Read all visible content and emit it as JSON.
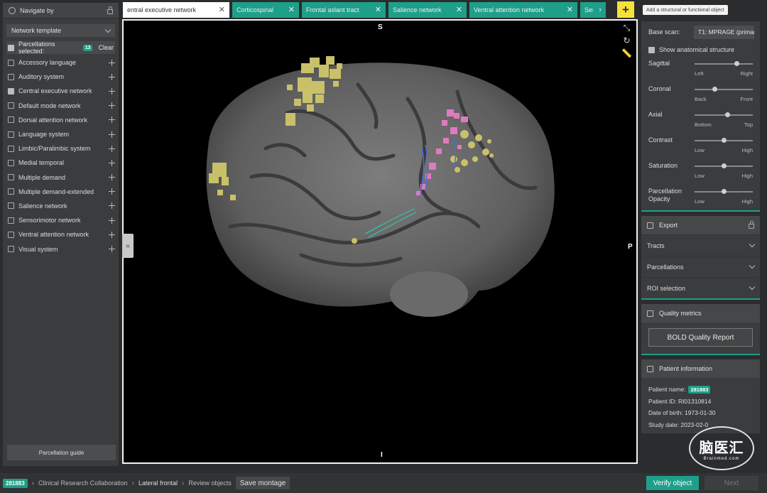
{
  "sidebar": {
    "title": "Navigate by",
    "template_select": "Network template",
    "selected_label": "Parcellations selected:",
    "selected_count": "13",
    "clear_label": "Clear",
    "networks": [
      {
        "label": "Accessory language",
        "checked": false
      },
      {
        "label": "Auditory system",
        "checked": false
      },
      {
        "label": "Central executive network",
        "checked": true
      },
      {
        "label": "Default mode network",
        "checked": false
      },
      {
        "label": "Dorsal attention network",
        "checked": false
      },
      {
        "label": "Language system",
        "checked": false
      },
      {
        "label": "Limbic/Paralimbic system",
        "checked": false
      },
      {
        "label": "Medial temporal",
        "checked": false
      },
      {
        "label": "Multiple demand",
        "checked": false
      },
      {
        "label": "Multiple demand-extended",
        "checked": false
      },
      {
        "label": "Salience network",
        "checked": false
      },
      {
        "label": "Sensorimotor network",
        "checked": false
      },
      {
        "label": "Ventral attention network",
        "checked": false
      },
      {
        "label": "Visual system",
        "checked": false
      }
    ],
    "guide_button": "Parcellation guide"
  },
  "tabs": [
    {
      "label": "entral executive network",
      "active": true
    },
    {
      "label": "Corticospinal",
      "active": false
    },
    {
      "label": "Frontal aslant tract",
      "active": false
    },
    {
      "label": "Salience network",
      "active": false
    },
    {
      "label": "Ventral attention network",
      "active": false
    },
    {
      "label": "Senso",
      "active": false
    }
  ],
  "add_button": "+",
  "add_tooltip": "Add a structural or functional object",
  "viewer": {
    "orient_top": "S",
    "orient_right": "P",
    "orient_bottom": "I",
    "collapse_glyph": "«"
  },
  "right": {
    "base_scan_label": "Base scan:",
    "base_scan_value": "T1: MPRAGE (primar",
    "show_anatomical": "Show anatomical structure",
    "sliders": [
      {
        "name": "Sagittal",
        "lo": "Left",
        "hi": "Right",
        "value": 0.72
      },
      {
        "name": "Coronal",
        "lo": "Back",
        "hi": "Front",
        "value": 0.34
      },
      {
        "name": "Axial",
        "lo": "Bottom",
        "hi": "Top",
        "value": 0.56
      },
      {
        "name": "Contrast",
        "lo": "Low",
        "hi": "High",
        "value": 0.5
      },
      {
        "name": "Saturation",
        "lo": "Low",
        "hi": "High",
        "value": 0.5
      },
      {
        "name": "Parcellation Opacity",
        "lo": "Low",
        "hi": "High",
        "value": 0.5
      }
    ],
    "export_label": "Export",
    "export_items": [
      "Tracts",
      "Parcellations",
      "ROI selection"
    ],
    "quality_label": "Quality metrics",
    "bold_button": "BOLD Quality Report",
    "patient_label": "Patient information",
    "patient_name_label": "Patient name:",
    "patient_name": "281883",
    "patient_id": "Patient ID: RI01310814",
    "dob": "Date of birth: 1973-01-30",
    "study_date": "Study date: 2023-02-0"
  },
  "bottom": {
    "id_badge": "281883",
    "crumbs": [
      "Clinical Research Collaboration",
      "Lateral frontal",
      "Review objects"
    ],
    "save_montage": "Save montage",
    "verify": "Verify object",
    "next": "Next"
  },
  "watermark": {
    "big": "脑医汇",
    "small": "Brainmed.com"
  },
  "colors": {
    "accent": "#1e9f8a",
    "add": "#f4e23a",
    "parcel_yellow": "#c9c06a",
    "parcel_pink": "#e07ac0"
  }
}
